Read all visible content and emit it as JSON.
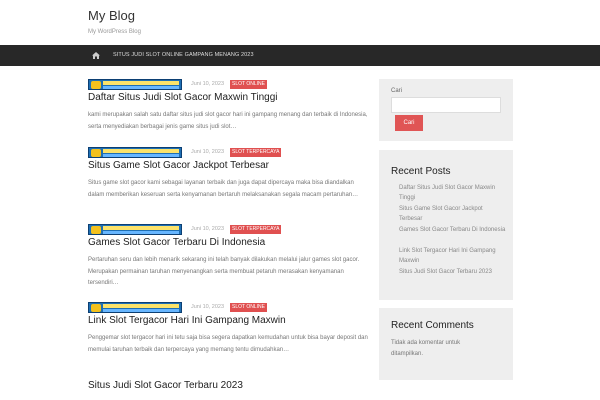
{
  "site": {
    "title": "My Blog",
    "description": "My WordPress Blog"
  },
  "nav": {
    "home_icon": "home-icon",
    "items": [
      "SITUS JUDI SLOT ONLINE GAMPANG MENANG 2023"
    ]
  },
  "posts": [
    {
      "date": "Juni 10, 2023",
      "category": "SLOT ONLINE",
      "title": "Daftar Situs Judi Slot Gacor Maxwin Tinggi",
      "excerpt": "kami merupakan salah satu daftar situs judi slot gacor hari ini gampang menang dan terbaik di Indonesia, serta menyediakan berbagai jenis game situs judi slot…"
    },
    {
      "date": "Juni 10, 2023",
      "category": "SLOT TERPERCAYA",
      "title": "Situs Game Slot Gacor Jackpot Terbesar",
      "excerpt": "Situs game slot gacor kami sebagai layanan terbaik dan juga dapat dipercaya maka bisa diandalkan dalam memberikan keseruan serta kenyamanan bertaruh melaksanakan segala macam pertaruhan…"
    },
    {
      "date": "Juni 10, 2023",
      "category": "SLOT TERPERCAYA",
      "title": "Games Slot Gacor Terbaru Di Indonesia",
      "excerpt": "Pertaruhan seru dan lebih menarik sekarang ini telah banyak dilakukan melalui jalur games slot gacor. Merupakan permainan taruhan menyenangkan serta membuat petaruh merasakan kenyamanan tersendiri…"
    },
    {
      "date": "Juni 10, 2023",
      "category": "SLOT ONLINE",
      "title": "Link Slot Tergacor Hari Ini Gampang Maxwin",
      "excerpt": "Penggemar slot tergacor hari ini tetu saja bisa segera dapatkan kemudahan untuk bisa bayar deposit dan memulai taruhan terbaik dan terpercaya yang memang tentu dimudahkan…"
    },
    {
      "date": "",
      "category": "",
      "title": "Situs Judi Slot Gacor Terbaru 2023",
      "excerpt": ""
    }
  ],
  "sidebar": {
    "search": {
      "label": "Cari",
      "placeholder": "",
      "button": "Cari"
    },
    "recent_posts": {
      "title": "Recent Posts",
      "items": [
        "Daftar Situs Judi Slot Gacor Maxwin Tinggi",
        "Situs Game Slot Gacor Jackpot Terbesar",
        "Games Slot Gacor Terbaru Di Indonesia",
        "Link Slot Tergacor Hari Ini Gampang Maxwin",
        "Situs Judi Slot Gacor Terbaru 2023"
      ]
    },
    "recent_comments": {
      "title": "Recent Comments",
      "empty_text": "Tidak ada komentar untuk ditampilkan."
    }
  },
  "colors": {
    "nav_bg": "#282828",
    "accent": "#e05050",
    "sidebar_bg": "#eeeeee"
  }
}
